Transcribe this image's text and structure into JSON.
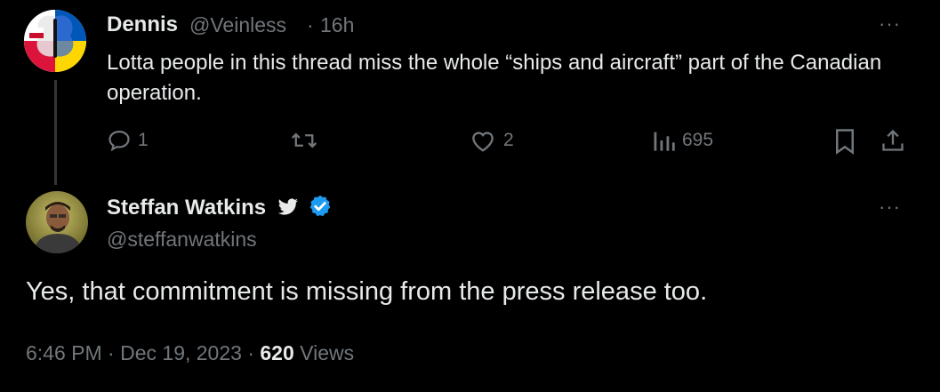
{
  "reply": {
    "display_name": "Dennis",
    "handle": "@Veinless",
    "separator": "·",
    "time": "16h",
    "text": "Lotta people in this thread miss the whole “ships and aircraft” part of the Canadian operation.",
    "more_label": "···",
    "replies": "1",
    "likes": "2",
    "views": "695",
    "icons": [
      "reply-icon",
      "retweet-icon",
      "like-icon",
      "views-icon",
      "bookmark-icon",
      "share-icon"
    ]
  },
  "main": {
    "display_name": "Steffan Watkins",
    "handle": "@steffanwatkins",
    "more_label": "···",
    "text": "Yes, that commitment is missing from the press release too.",
    "time": "6:46 PM",
    "separator": "·",
    "date": "Dec 19, 2023",
    "views_count": "620",
    "views_label": "Views",
    "icons": [
      "bird-icon",
      "verified-badge-icon"
    ]
  },
  "colors": {
    "background": "#000000",
    "text": "#e7e9ea",
    "muted": "#71767b",
    "verified": "#1d9bf0",
    "thread_line": "#333639"
  }
}
